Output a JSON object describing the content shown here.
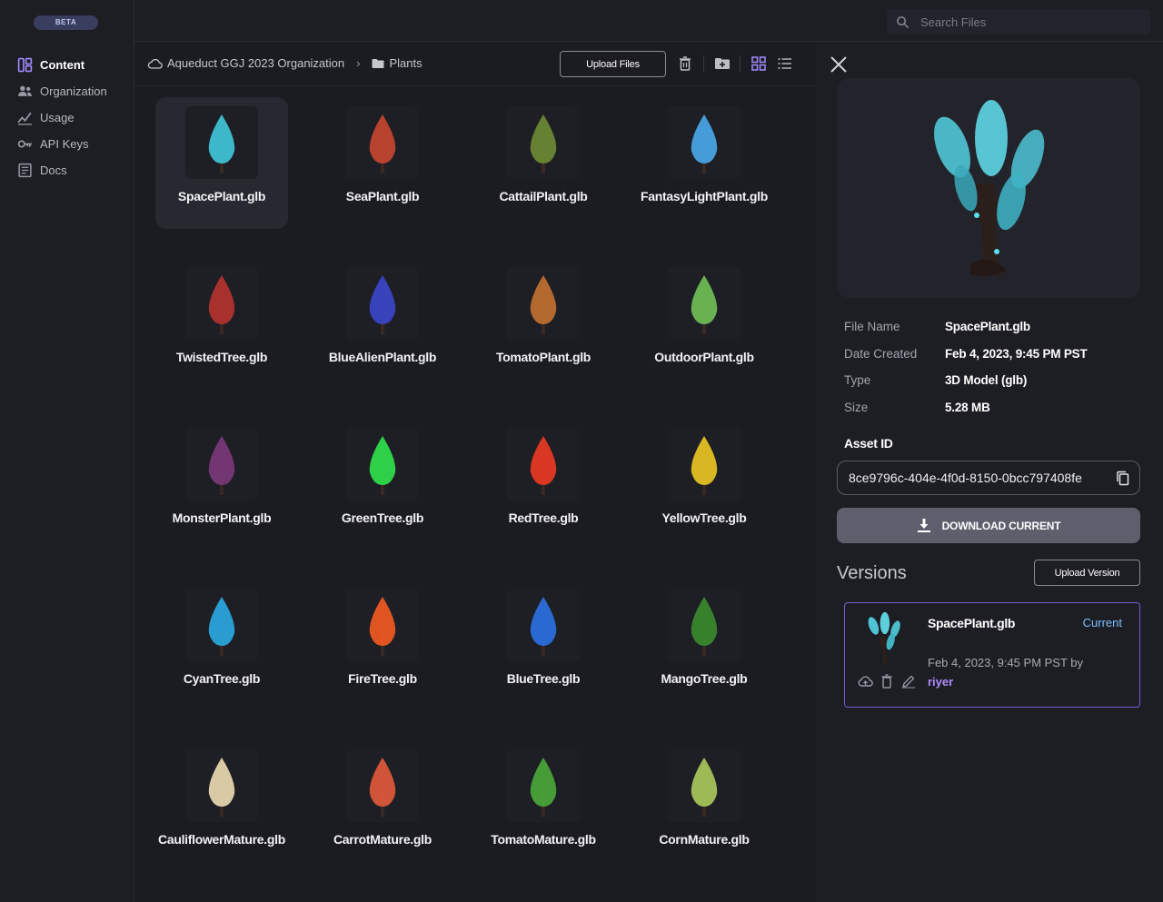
{
  "sidebar": {
    "badge": "BETA",
    "items": [
      {
        "label": "Content",
        "icon": "content-icon",
        "active": true
      },
      {
        "label": "Organization",
        "icon": "users-icon",
        "active": false
      },
      {
        "label": "Usage",
        "icon": "chart-icon",
        "active": false
      },
      {
        "label": "API Keys",
        "icon": "key-icon",
        "active": false
      },
      {
        "label": "Docs",
        "icon": "docs-icon",
        "active": false
      }
    ]
  },
  "search": {
    "placeholder": "Search Files",
    "value": ""
  },
  "breadcrumb": {
    "organization": "Aqueduct GGJ 2023 Organization",
    "folder": "Plants"
  },
  "toolbar": {
    "upload_label": "Upload Files"
  },
  "files": [
    {
      "name": "SpacePlant.glb",
      "selected": true,
      "color": "#3fc6d8"
    },
    {
      "name": "SeaPlant.glb",
      "selected": false,
      "color": "#c4452e"
    },
    {
      "name": "CattailPlant.glb",
      "selected": false,
      "color": "#6d8a32"
    },
    {
      "name": "FantasyLightPlant.glb",
      "selected": false,
      "color": "#4aa6e8"
    },
    {
      "name": "TwistedTree.glb",
      "selected": false,
      "color": "#b5332e"
    },
    {
      "name": "BlueAlienPlant.glb",
      "selected": false,
      "color": "#3a45c8"
    },
    {
      "name": "TomatoPlant.glb",
      "selected": false,
      "color": "#c0702f"
    },
    {
      "name": "OutdoorPlant.glb",
      "selected": false,
      "color": "#6fbf56"
    },
    {
      "name": "MonsterPlant.glb",
      "selected": false,
      "color": "#7a3a7a"
    },
    {
      "name": "GreenTree.glb",
      "selected": false,
      "color": "#2fe04a"
    },
    {
      "name": "RedTree.glb",
      "selected": false,
      "color": "#e83a22"
    },
    {
      "name": "YellowTree.glb",
      "selected": false,
      "color": "#e8c422"
    },
    {
      "name": "CyanTree.glb",
      "selected": false,
      "color": "#2aa8e0"
    },
    {
      "name": "FireTree.glb",
      "selected": false,
      "color": "#f05a22"
    },
    {
      "name": "BlueTree.glb",
      "selected": false,
      "color": "#2a70e0"
    },
    {
      "name": "MangoTree.glb",
      "selected": false,
      "color": "#3a8a2e"
    },
    {
      "name": "CauliflowerMature.glb",
      "selected": false,
      "color": "#e8d9b0"
    },
    {
      "name": "CarrotMature.glb",
      "selected": false,
      "color": "#e05a3a"
    },
    {
      "name": "TomatoMature.glb",
      "selected": false,
      "color": "#4aa83a"
    },
    {
      "name": "CornMature.glb",
      "selected": false,
      "color": "#a8c85a"
    }
  ],
  "details": {
    "properties": [
      {
        "key": "File Name",
        "value": "SpacePlant.glb"
      },
      {
        "key": "Date Created",
        "value": "Feb 4, 2023, 9:45 PM PST"
      },
      {
        "key": "Type",
        "value": "3D Model (glb)"
      },
      {
        "key": "Size",
        "value": "5.28 MB"
      }
    ],
    "asset_id_label": "Asset ID",
    "asset_id": "8ce9796c-404e-4f0d-8150-0bcc797408fe",
    "download_label": "DOWNLOAD CURRENT",
    "versions_title": "Versions",
    "upload_version_label": "Upload Version",
    "version": {
      "name": "SpacePlant.glb",
      "status": "Current",
      "meta": "Feb 4, 2023, 9:45 PM PST by",
      "user": "riyer"
    }
  },
  "colors": {
    "accent": "#7c5ad0",
    "current": "#7cc0ff",
    "user": "#b08cff"
  }
}
